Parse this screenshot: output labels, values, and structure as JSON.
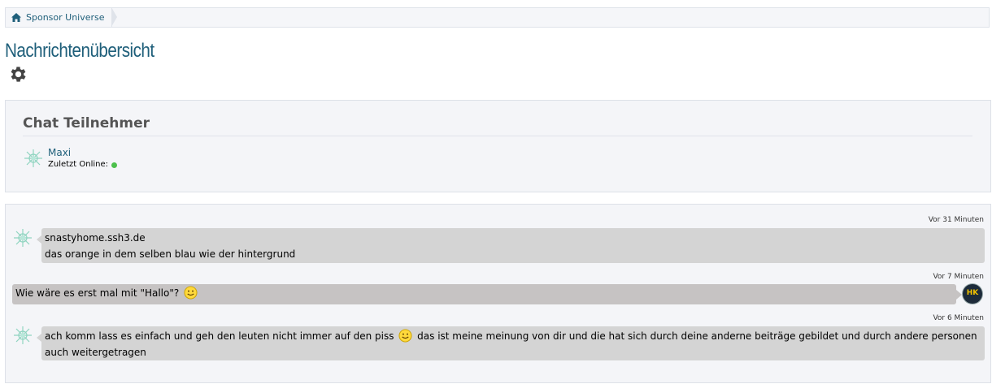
{
  "breadcrumb": {
    "home_label": "Sponsor Universe"
  },
  "page": {
    "title": "Nachrichtenübersicht"
  },
  "members_panel": {
    "heading": "Chat Teilnehmer",
    "members": [
      {
        "name": "Maxi",
        "status_label": "Zuletzt Online:",
        "online": true
      }
    ]
  },
  "chat": {
    "messages": [
      {
        "time": "Vor 31 Minuten",
        "line1": "snastyhome.ssh3.de",
        "line2": "das orange in dem selben blau wie der hintergrund",
        "direction": "incoming"
      },
      {
        "time": "Vor 7 Minuten",
        "text_before": "Wie wäre es erst mal mit \"Hallo\"?",
        "emoji": "smiley",
        "direction": "outgoing",
        "avatar_text": "HK"
      },
      {
        "time": "Vor 6 Minuten",
        "text_before": "ach komm lass es einfach und geh den leuten nicht immer auf den piss",
        "emoji": "smiley",
        "text_after": "das ist meine meinung von dir und die hat sich durch deine anderne beiträge gebildet und durch andere personen auch weitergetragen",
        "direction": "incoming"
      }
    ]
  },
  "colors": {
    "link": "#1f5f7a",
    "online": "#4cc04c"
  }
}
